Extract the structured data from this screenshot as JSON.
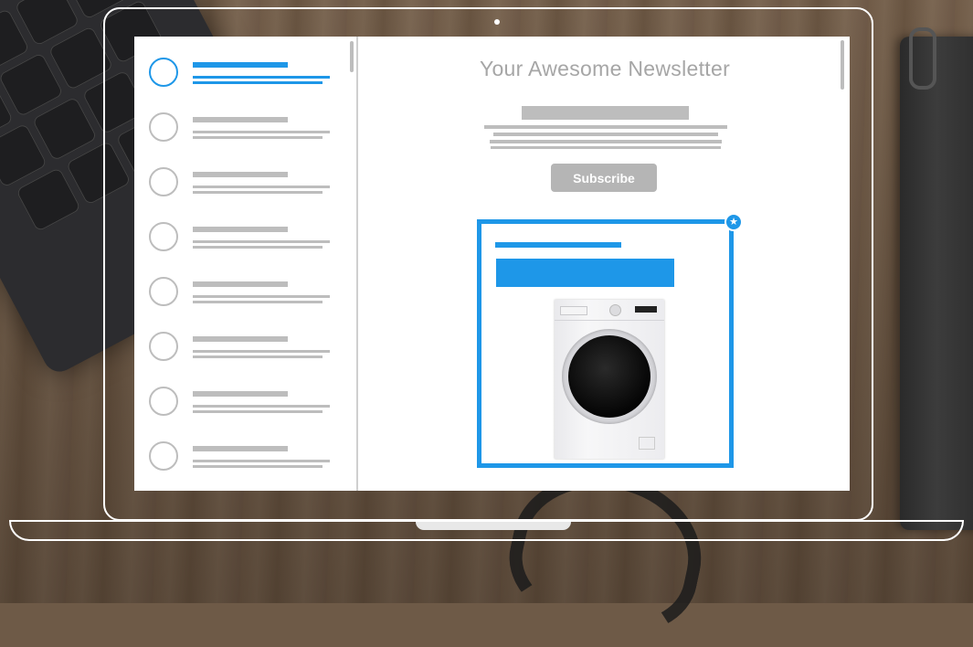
{
  "newsletter": {
    "title": "Your Awesome Newsletter",
    "subscribe_label": "Subscribe"
  },
  "inbox": {
    "items": [
      {
        "state": "selected"
      },
      {
        "state": "default"
      },
      {
        "state": "default"
      },
      {
        "state": "default"
      },
      {
        "state": "default"
      },
      {
        "state": "default"
      },
      {
        "state": "default"
      },
      {
        "state": "default"
      }
    ]
  },
  "featured_card": {
    "badge_icon": "star-icon",
    "image": "washing-machine"
  },
  "colors": {
    "accent": "#1e97e8",
    "placeholder": "#bdbdbd",
    "title_text": "#a6a6a6",
    "button_bg": "#b5b5b5"
  }
}
